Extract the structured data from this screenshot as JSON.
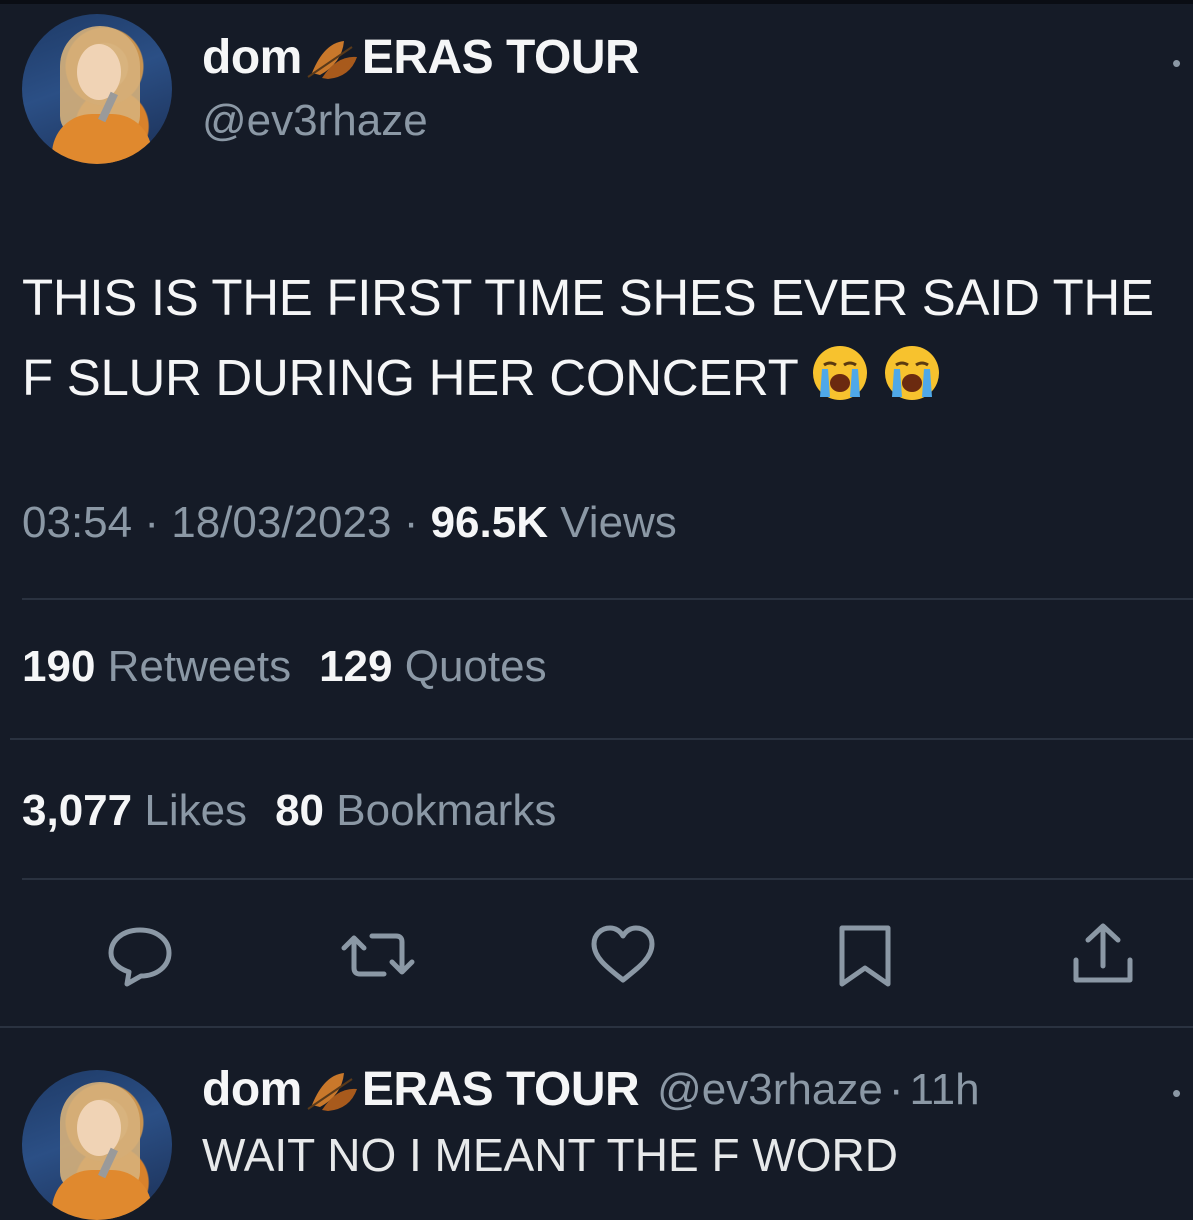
{
  "tweet": {
    "display_name": "dom",
    "display_name_suffix": "ERAS TOUR",
    "handle": "@ev3rhaze",
    "text": "THIS IS THE FIRST TIME SHES EVER SAID THE F SLUR DURING HER CONCERT",
    "emojis": [
      "loudly-crying-face-icon",
      "loudly-crying-face-icon"
    ],
    "time": "03:54",
    "date": "18/03/2023",
    "views_count": "96.5K",
    "views_label": "Views",
    "retweets_count": "190",
    "retweets_label": "Retweets",
    "quotes_count": "129",
    "quotes_label": "Quotes",
    "likes_count": "3,077",
    "likes_label": "Likes",
    "bookmarks_count": "80",
    "bookmarks_label": "Bookmarks"
  },
  "actions": [
    "reply-icon",
    "retweet-icon",
    "like-icon",
    "bookmark-icon",
    "share-icon"
  ],
  "reply": {
    "display_name": "dom",
    "display_name_suffix": "ERAS TOUR",
    "handle": "@ev3rhaze",
    "separator": "·",
    "age": "11h",
    "text": "WAIT NO I MEANT THE F WORD"
  },
  "colors": {
    "background": "#151b27",
    "text": "#f5f6f7",
    "muted": "#8b98a5",
    "divider": "#2a3240"
  }
}
